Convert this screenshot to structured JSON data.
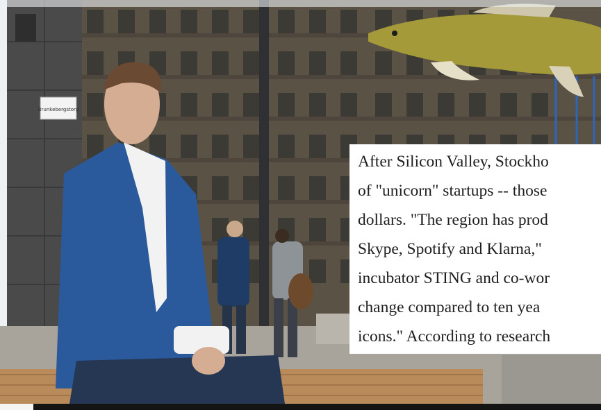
{
  "photo": {
    "street_sign": "Brunkebergstorg",
    "colors": {
      "building": "#5b5246",
      "window": "#3c3a35",
      "sky": "#cfd6dc",
      "blazer": "#2b5a9c",
      "bench_wood": "#b98a5a",
      "fish_body": "#a49a3a",
      "caption_bg": "#ffffff",
      "caption_text": "#1f1f1f"
    }
  },
  "caption": {
    "lines": [
      "After Silicon Valley, Stockho",
      "of \"unicorn\" startups -- those",
      "dollars. \"The region has prod",
      "Skype, Spotify and Klarna,\"",
      "incubator STING and co-wor",
      "change compared to ten yea",
      "icons.\" According to research"
    ]
  }
}
